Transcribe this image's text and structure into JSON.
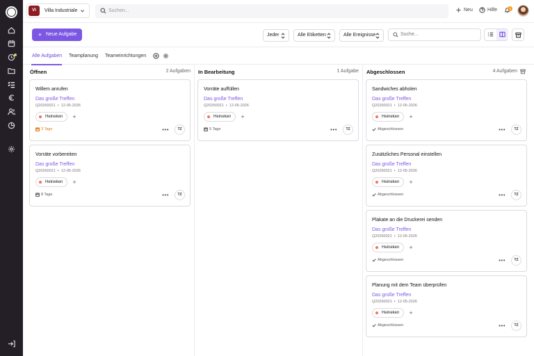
{
  "sidebar": {
    "logo_letter": "M",
    "items": [
      {
        "icon": "home-icon"
      },
      {
        "icon": "calendar-icon"
      },
      {
        "icon": "events-icon"
      },
      {
        "icon": "folder-icon"
      },
      {
        "icon": "tasks-icon"
      },
      {
        "icon": "euro-icon"
      },
      {
        "icon": "contacts-icon"
      },
      {
        "icon": "reports-icon"
      },
      {
        "icon": "settings-icon"
      },
      {
        "icon": "logout-icon"
      }
    ]
  },
  "topbar": {
    "venue_initials": "VI",
    "venue_name": "Villa Industriale",
    "search_placeholder": "Suchen...",
    "new_label": "Neu",
    "help_label": "Hilfe",
    "notification_count": "3"
  },
  "toolbar": {
    "new_task_label": "Neue Aufgabe",
    "filter_assignee": "Jeder",
    "filter_labels": "Alle Etiketten",
    "filter_events": "Alle Ereignisse",
    "search_placeholder": "Suche..."
  },
  "tabs": [
    {
      "label": "Alle Aufgaben",
      "active": true
    },
    {
      "label": "Teamplanung",
      "active": false
    },
    {
      "label": "Teameinrichtungen",
      "active": false
    }
  ],
  "columns": [
    {
      "title": "Öffnen",
      "count": "2 Aufgaben",
      "cards": [
        {
          "title": "Willem anrufen",
          "event": "Das große Treffen",
          "code": "Q20260021",
          "date": "12-05-2026",
          "label": "Heineken",
          "footer": "3 Tage",
          "footer_type": "warn",
          "assignee": "TZ"
        },
        {
          "title": "Vorräte vorbereiten",
          "event": "Das große Treffen",
          "code": "Q20260021",
          "date": "12-05-2026",
          "label": "Heineken",
          "footer": "8 Tage",
          "footer_type": "date",
          "assignee": "TZ"
        }
      ]
    },
    {
      "title": "In Bearbeitung",
      "count": "1 Aufgabe",
      "cards": [
        {
          "title": "Vorräte auffüllen",
          "event": "Das große Treffen",
          "code": "Q20260021",
          "date": "12-05-2026",
          "label": "Heineken",
          "footer": "5 Tage",
          "footer_type": "date",
          "assignee": "TZ"
        }
      ]
    },
    {
      "title": "Abgeschlossen",
      "count": "4 Aufgaben",
      "cards": [
        {
          "title": "Sandwiches abholen",
          "event": "Das große Treffen",
          "code": "Q20260021",
          "date": "12-05-2026",
          "label": "Heineken",
          "footer": "Abgeschlossen",
          "footer_type": "done",
          "assignee": "TZ"
        },
        {
          "title": "Zusätzliches Personal einstellen",
          "event": "Das große Treffen",
          "code": "Q20260021",
          "date": "12-05-2026",
          "label": "Heineken",
          "footer": "Abgeschlossen",
          "footer_type": "done",
          "assignee": "TZ"
        },
        {
          "title": "Plakate an die Druckerei senden",
          "event": "Das große Treffen",
          "code": "Q20260021",
          "date": "12-05-2026",
          "label": "Heineken",
          "footer": "Abgeschlossen",
          "footer_type": "done",
          "assignee": "TZ"
        },
        {
          "title": "Planung mit dem Team überprüfen",
          "event": "Das große Treffen",
          "code": "Q20260021",
          "date": "12-05-2026",
          "label": "Heineken",
          "footer": "Abgeschlossen",
          "footer_type": "done",
          "assignee": "TZ"
        }
      ]
    }
  ],
  "colors": {
    "accent": "#7b57e4",
    "sidebar": "#241f26",
    "venue_badge": "#8e1b23",
    "warning": "#e07a10",
    "label_dot": "#f0715a"
  }
}
